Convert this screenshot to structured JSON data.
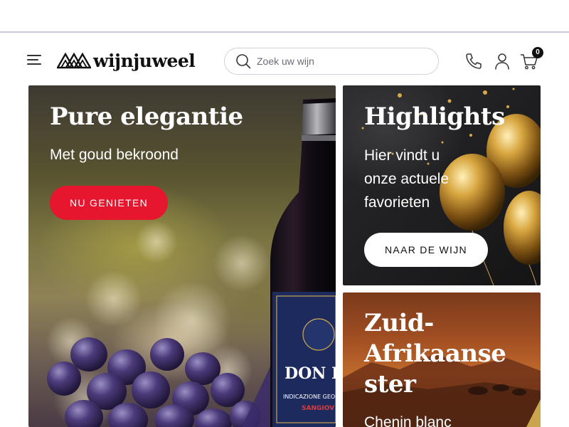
{
  "header": {
    "brand": "wijnjuweel",
    "search_placeholder": "Zoek uw wijn",
    "cart_count": "0"
  },
  "cards": {
    "pure": {
      "title": "Pure elegantie",
      "subtitle": "Met goud bekroond",
      "button": "NU GENIETEN"
    },
    "highlights": {
      "title": "Highlights",
      "text": "Hier vindt u onze actuele favorieten",
      "button": "NAAR DE WIJN"
    },
    "south_africa": {
      "title": "Zuid-Afrikaanse ster",
      "text": "Chenin blanc"
    }
  },
  "colors": {
    "accent_red": "#e5162e",
    "text_dark": "#111111",
    "border": "#cfd2d8"
  },
  "icons": [
    "menu-icon",
    "brand-mountain-icon",
    "search-icon",
    "phone-icon",
    "user-icon",
    "cart-icon"
  ]
}
